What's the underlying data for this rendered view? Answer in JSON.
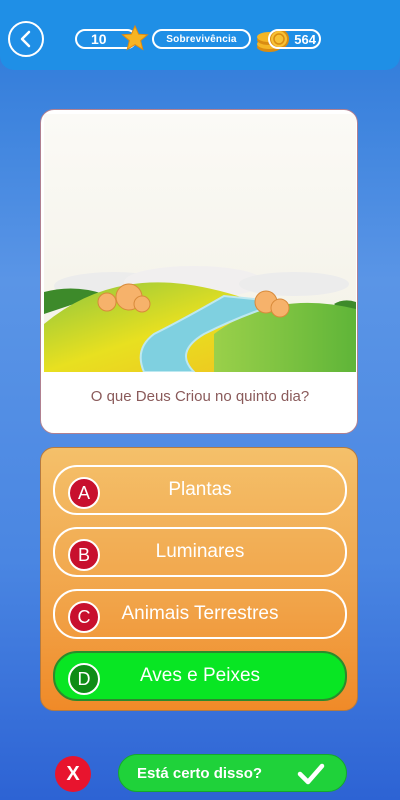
{
  "header": {
    "level": "10",
    "mode": "Sobrevivência",
    "coins": "564",
    "icons": [
      "back-arrow-icon",
      "star-icon",
      "coins-icon"
    ]
  },
  "question": {
    "text": "O que Deus Criou no quinto dia?"
  },
  "options": [
    {
      "letter": "A",
      "text": "Plantas",
      "selected": false
    },
    {
      "letter": "B",
      "text": "Luminares",
      "selected": false
    },
    {
      "letter": "C",
      "text": "Animais Terrestres",
      "selected": false
    },
    {
      "letter": "D",
      "text": "Aves e Peixes",
      "selected": true
    }
  ],
  "footer": {
    "cancel_label": "X",
    "confirm_label": "Está certo disso?"
  },
  "colors": {
    "header_bg": "#1f8fe6",
    "answer_panel": "#f1a348",
    "selected_option": "#08e623",
    "letter_badge": "#c8102e",
    "confirm_button": "#1fd23a",
    "cancel_button": "#e8142e"
  }
}
